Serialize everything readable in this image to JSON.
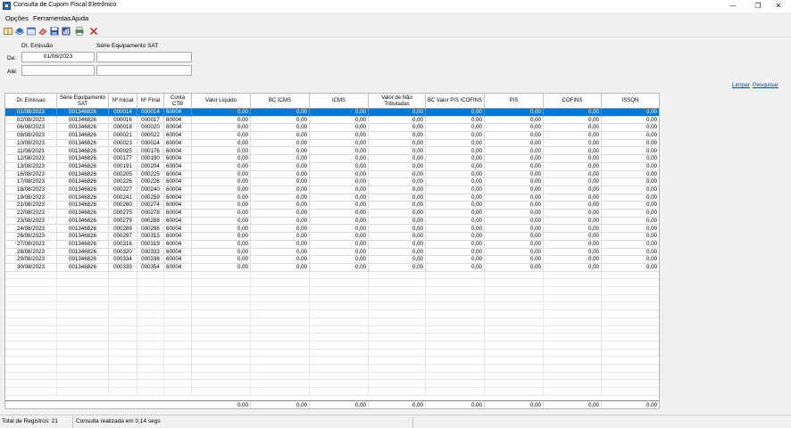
{
  "window": {
    "title": "Consulta de Cupom Fiscal Eletrônico",
    "minimize_glyph": "—",
    "restore_glyph": "❐",
    "close_glyph": "✕"
  },
  "menu": {
    "items": [
      "Opções",
      "Ferramentas",
      "Ajuda"
    ]
  },
  "toolbar": {
    "icons": [
      "book-icon",
      "layers-icon",
      "window-icon",
      "eraser-icon",
      "save-icon",
      "chart-icon",
      "print-icon",
      "delete-icon"
    ]
  },
  "filter": {
    "dt_emissao_label": "Dt. Emissão",
    "serie_label": "Série Equipamento SAT",
    "de_label": "De:",
    "ate_label": "Até:",
    "dt_de_value": "01/08/2023",
    "dt_ate_value": "",
    "serie_de_value": "",
    "serie_ate_value": ""
  },
  "links": {
    "limpar": "Limpar",
    "pesquisar": "Pesquisar"
  },
  "grid": {
    "headers": [
      "Dt. Emissao",
      "Série Equipamento SAT",
      "Nº Inicial",
      "Nº Final",
      "Conta CTB",
      "Valor Líquido",
      "BC ICMS",
      "ICMS",
      "Valor de Não Tributadas",
      "BC Valor PIS /COFINS",
      "PIS",
      "COFINS",
      "ISSQN"
    ],
    "rows": [
      [
        "01/08/2023",
        "001346826",
        "000014",
        "000014",
        "60004",
        "0,00",
        "0,00",
        "0,00",
        "0,00",
        "0,00",
        "0,00",
        "0,00",
        "0,00"
      ],
      [
        "02/08/2023",
        "001346826",
        "000016",
        "000017",
        "60004",
        "0,00",
        "0,00",
        "0,00",
        "0,00",
        "0,00",
        "0,00",
        "0,00",
        "0,00"
      ],
      [
        "06/08/2023",
        "001346826",
        "000018",
        "000020",
        "60004",
        "0,00",
        "0,00",
        "0,00",
        "0,00",
        "0,00",
        "0,00",
        "0,00",
        "0,00"
      ],
      [
        "08/08/2023",
        "001346826",
        "000021",
        "000022",
        "60004",
        "0,00",
        "0,00",
        "0,00",
        "0,00",
        "0,00",
        "0,00",
        "0,00",
        "0,00"
      ],
      [
        "10/08/2023",
        "001346826",
        "000023",
        "000024",
        "60004",
        "0,00",
        "0,00",
        "0,00",
        "0,00",
        "0,00",
        "0,00",
        "0,00",
        "0,00"
      ],
      [
        "11/08/2023",
        "001346826",
        "000025",
        "000176",
        "60004",
        "0,00",
        "0,00",
        "0,00",
        "0,00",
        "0,00",
        "0,00",
        "0,00",
        "0,00"
      ],
      [
        "12/08/2023",
        "001346826",
        "000177",
        "000190",
        "60004",
        "0,00",
        "0,00",
        "0,00",
        "0,00",
        "0,00",
        "0,00",
        "0,00",
        "0,00"
      ],
      [
        "13/08/2023",
        "001346826",
        "000191",
        "000204",
        "60004",
        "0,00",
        "0,00",
        "0,00",
        "0,00",
        "0,00",
        "0,00",
        "0,00",
        "0,00"
      ],
      [
        "16/08/2023",
        "001346826",
        "000205",
        "000225",
        "60004",
        "0,00",
        "0,00",
        "0,00",
        "0,00",
        "0,00",
        "0,00",
        "0,00",
        "0,00"
      ],
      [
        "17/08/2023",
        "001346826",
        "000226",
        "000226",
        "60004",
        "0,00",
        "0,00",
        "0,00",
        "0,00",
        "0,00",
        "0,00",
        "0,00",
        "0,00"
      ],
      [
        "18/08/2023",
        "001346826",
        "000227",
        "000240",
        "60004",
        "0,00",
        "0,00",
        "0,00",
        "0,00",
        "0,00",
        "0,00",
        "0,00",
        "0,00"
      ],
      [
        "19/08/2023",
        "001346826",
        "000241",
        "000259",
        "60004",
        "0,00",
        "0,00",
        "0,00",
        "0,00",
        "0,00",
        "0,00",
        "0,00",
        "0,00"
      ],
      [
        "21/08/2023",
        "001346826",
        "000260",
        "000274",
        "60004",
        "0,00",
        "0,00",
        "0,00",
        "0,00",
        "0,00",
        "0,00",
        "0,00",
        "0,00"
      ],
      [
        "22/08/2023",
        "001346826",
        "000275",
        "000278",
        "60004",
        "0,00",
        "0,00",
        "0,00",
        "0,00",
        "0,00",
        "0,00",
        "0,00",
        "0,00"
      ],
      [
        "23/08/2023",
        "001346826",
        "000279",
        "000288",
        "60004",
        "0,00",
        "0,00",
        "0,00",
        "0,00",
        "0,00",
        "0,00",
        "0,00",
        "0,00"
      ],
      [
        "24/08/2023",
        "001346826",
        "000289",
        "000296",
        "60004",
        "0,00",
        "0,00",
        "0,00",
        "0,00",
        "0,00",
        "0,00",
        "0,00",
        "0,00"
      ],
      [
        "26/08/2023",
        "001346826",
        "000297",
        "000315",
        "60004",
        "0,00",
        "0,00",
        "0,00",
        "0,00",
        "0,00",
        "0,00",
        "0,00",
        "0,00"
      ],
      [
        "27/08/2023",
        "001346826",
        "000316",
        "000319",
        "60004",
        "0,00",
        "0,00",
        "0,00",
        "0,00",
        "0,00",
        "0,00",
        "0,00",
        "0,00"
      ],
      [
        "28/08/2023",
        "001346826",
        "000320",
        "000333",
        "60004",
        "0,00",
        "0,00",
        "0,00",
        "0,00",
        "0,00",
        "0,00",
        "0,00",
        "0,00"
      ],
      [
        "29/08/2023",
        "001346826",
        "000334",
        "000338",
        "60004",
        "0,00",
        "0,00",
        "0,00",
        "0,00",
        "0,00",
        "0,00",
        "0,00",
        "0,00"
      ],
      [
        "30/08/2023",
        "001346826",
        "000339",
        "000354",
        "60004",
        "0,00",
        "0,00",
        "0,00",
        "0,00",
        "0,00",
        "0,00",
        "0,00",
        "0,00"
      ]
    ],
    "selected_row": 0,
    "totals": [
      "0,00",
      "0,00",
      "0,00",
      "0,00",
      "0,00",
      "0,00",
      "0,00",
      "0,00"
    ]
  },
  "status": {
    "total_registros": "Total de Registros: 21",
    "consulta": "Consulta realizada em 0,14 segs"
  },
  "colors": {
    "selection": "#0078d7",
    "link": "#0645ad",
    "delete_icon": "#d9302b"
  }
}
